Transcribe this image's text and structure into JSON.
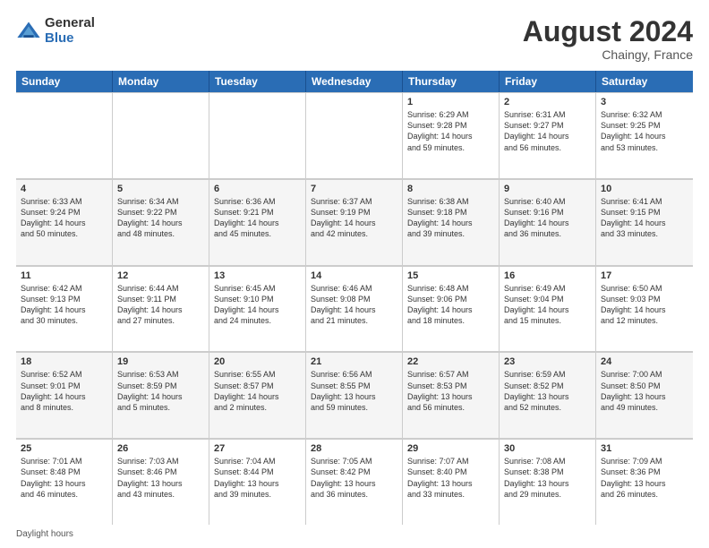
{
  "logo": {
    "general": "General",
    "blue": "Blue"
  },
  "header": {
    "month": "August 2024",
    "location": "Chaingy, France"
  },
  "days": [
    "Sunday",
    "Monday",
    "Tuesday",
    "Wednesday",
    "Thursday",
    "Friday",
    "Saturday"
  ],
  "weeks": [
    [
      {
        "day": "",
        "info": ""
      },
      {
        "day": "",
        "info": ""
      },
      {
        "day": "",
        "info": ""
      },
      {
        "day": "",
        "info": ""
      },
      {
        "day": "1",
        "info": "Sunrise: 6:29 AM\nSunset: 9:28 PM\nDaylight: 14 hours\nand 59 minutes."
      },
      {
        "day": "2",
        "info": "Sunrise: 6:31 AM\nSunset: 9:27 PM\nDaylight: 14 hours\nand 56 minutes."
      },
      {
        "day": "3",
        "info": "Sunrise: 6:32 AM\nSunset: 9:25 PM\nDaylight: 14 hours\nand 53 minutes."
      }
    ],
    [
      {
        "day": "4",
        "info": "Sunrise: 6:33 AM\nSunset: 9:24 PM\nDaylight: 14 hours\nand 50 minutes."
      },
      {
        "day": "5",
        "info": "Sunrise: 6:34 AM\nSunset: 9:22 PM\nDaylight: 14 hours\nand 48 minutes."
      },
      {
        "day": "6",
        "info": "Sunrise: 6:36 AM\nSunset: 9:21 PM\nDaylight: 14 hours\nand 45 minutes."
      },
      {
        "day": "7",
        "info": "Sunrise: 6:37 AM\nSunset: 9:19 PM\nDaylight: 14 hours\nand 42 minutes."
      },
      {
        "day": "8",
        "info": "Sunrise: 6:38 AM\nSunset: 9:18 PM\nDaylight: 14 hours\nand 39 minutes."
      },
      {
        "day": "9",
        "info": "Sunrise: 6:40 AM\nSunset: 9:16 PM\nDaylight: 14 hours\nand 36 minutes."
      },
      {
        "day": "10",
        "info": "Sunrise: 6:41 AM\nSunset: 9:15 PM\nDaylight: 14 hours\nand 33 minutes."
      }
    ],
    [
      {
        "day": "11",
        "info": "Sunrise: 6:42 AM\nSunset: 9:13 PM\nDaylight: 14 hours\nand 30 minutes."
      },
      {
        "day": "12",
        "info": "Sunrise: 6:44 AM\nSunset: 9:11 PM\nDaylight: 14 hours\nand 27 minutes."
      },
      {
        "day": "13",
        "info": "Sunrise: 6:45 AM\nSunset: 9:10 PM\nDaylight: 14 hours\nand 24 minutes."
      },
      {
        "day": "14",
        "info": "Sunrise: 6:46 AM\nSunset: 9:08 PM\nDaylight: 14 hours\nand 21 minutes."
      },
      {
        "day": "15",
        "info": "Sunrise: 6:48 AM\nSunset: 9:06 PM\nDaylight: 14 hours\nand 18 minutes."
      },
      {
        "day": "16",
        "info": "Sunrise: 6:49 AM\nSunset: 9:04 PM\nDaylight: 14 hours\nand 15 minutes."
      },
      {
        "day": "17",
        "info": "Sunrise: 6:50 AM\nSunset: 9:03 PM\nDaylight: 14 hours\nand 12 minutes."
      }
    ],
    [
      {
        "day": "18",
        "info": "Sunrise: 6:52 AM\nSunset: 9:01 PM\nDaylight: 14 hours\nand 8 minutes."
      },
      {
        "day": "19",
        "info": "Sunrise: 6:53 AM\nSunset: 8:59 PM\nDaylight: 14 hours\nand 5 minutes."
      },
      {
        "day": "20",
        "info": "Sunrise: 6:55 AM\nSunset: 8:57 PM\nDaylight: 14 hours\nand 2 minutes."
      },
      {
        "day": "21",
        "info": "Sunrise: 6:56 AM\nSunset: 8:55 PM\nDaylight: 13 hours\nand 59 minutes."
      },
      {
        "day": "22",
        "info": "Sunrise: 6:57 AM\nSunset: 8:53 PM\nDaylight: 13 hours\nand 56 minutes."
      },
      {
        "day": "23",
        "info": "Sunrise: 6:59 AM\nSunset: 8:52 PM\nDaylight: 13 hours\nand 52 minutes."
      },
      {
        "day": "24",
        "info": "Sunrise: 7:00 AM\nSunset: 8:50 PM\nDaylight: 13 hours\nand 49 minutes."
      }
    ],
    [
      {
        "day": "25",
        "info": "Sunrise: 7:01 AM\nSunset: 8:48 PM\nDaylight: 13 hours\nand 46 minutes."
      },
      {
        "day": "26",
        "info": "Sunrise: 7:03 AM\nSunset: 8:46 PM\nDaylight: 13 hours\nand 43 minutes."
      },
      {
        "day": "27",
        "info": "Sunrise: 7:04 AM\nSunset: 8:44 PM\nDaylight: 13 hours\nand 39 minutes."
      },
      {
        "day": "28",
        "info": "Sunrise: 7:05 AM\nSunset: 8:42 PM\nDaylight: 13 hours\nand 36 minutes."
      },
      {
        "day": "29",
        "info": "Sunrise: 7:07 AM\nSunset: 8:40 PM\nDaylight: 13 hours\nand 33 minutes."
      },
      {
        "day": "30",
        "info": "Sunrise: 7:08 AM\nSunset: 8:38 PM\nDaylight: 13 hours\nand 29 minutes."
      },
      {
        "day": "31",
        "info": "Sunrise: 7:09 AM\nSunset: 8:36 PM\nDaylight: 13 hours\nand 26 minutes."
      }
    ]
  ],
  "footer": "Daylight hours"
}
